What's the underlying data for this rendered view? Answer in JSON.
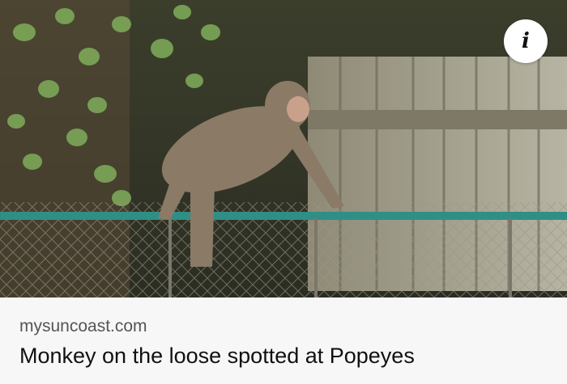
{
  "link_preview": {
    "domain": "mysuncoast.com",
    "headline": "Monkey on the loose spotted at Popeyes"
  },
  "info_button": {
    "glyph": "i",
    "icon": "info-icon"
  },
  "colors": {
    "caption_background": "#f7f7f7",
    "domain_text": "#555555",
    "headline_text": "#111111",
    "fence_rail": "#2f8f86"
  }
}
